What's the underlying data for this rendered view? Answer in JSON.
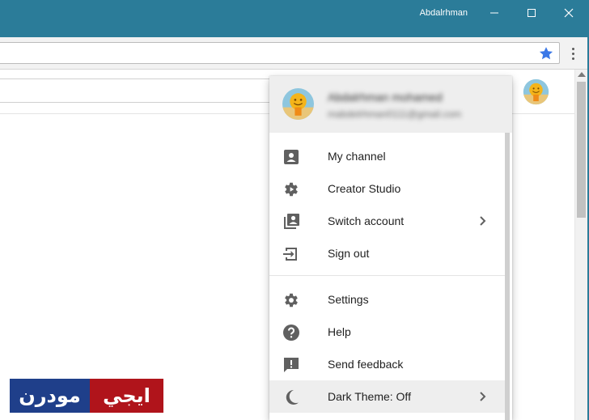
{
  "window": {
    "user_name": "Abdalrhman"
  },
  "omnibox": {
    "value": ""
  },
  "account": {
    "name": "Abdalrhman mohamed",
    "email": "mabdelrhman0111@gmail.com"
  },
  "menu": {
    "items": [
      {
        "label": "My channel",
        "icon": "account-box-icon",
        "has_submenu": false
      },
      {
        "label": "Creator Studio",
        "icon": "gear-play-icon",
        "has_submenu": false
      },
      {
        "label": "Switch account",
        "icon": "switch-account-icon",
        "has_submenu": true
      },
      {
        "label": "Sign out",
        "icon": "sign-out-icon",
        "has_submenu": false
      },
      {
        "label": "Settings",
        "icon": "gear-icon",
        "has_submenu": false
      },
      {
        "label": "Help",
        "icon": "help-icon",
        "has_submenu": false
      },
      {
        "label": "Send feedback",
        "icon": "feedback-icon",
        "has_submenu": false
      },
      {
        "label": "Dark Theme: Off",
        "icon": "moon-icon",
        "has_submenu": true
      }
    ]
  },
  "watermark": {
    "left_text": "مودرن",
    "right_text": "ايجي"
  },
  "colors": {
    "titlebar": "#2b7c99",
    "star": "#3b78e7",
    "menu_header": "#eeeeee",
    "watermark_blue": "#1f3f8a",
    "watermark_red": "#b0141b"
  }
}
